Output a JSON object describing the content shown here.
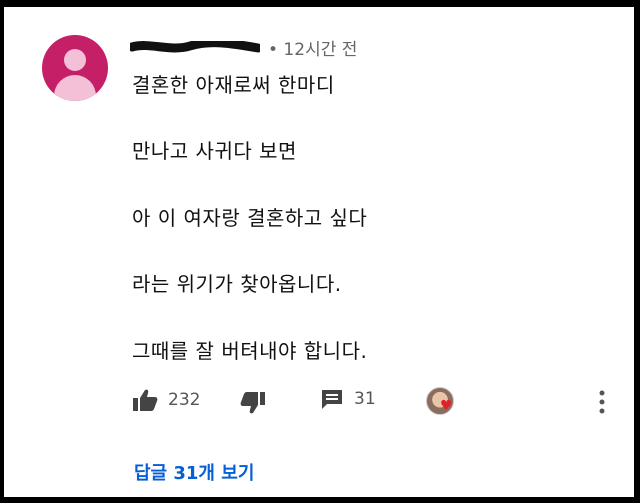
{
  "comment": {
    "timestamp": "• 12시간 전",
    "lines": [
      "결혼한 아재로써 한마디",
      "만나고 사귀다 보면",
      "아 이 여자랑 결혼하고 싶다",
      "라는 위기가 찾아옵니다.",
      "그때를 잘 버텨내야 합니다."
    ]
  },
  "actions": {
    "like_icon": "thumbs-up-icon",
    "like_count": "232",
    "dislike_icon": "thumbs-down-icon",
    "reply_icon": "comment-icon",
    "reply_count": "31",
    "creator_heart_icon": "creator-heart-icon",
    "more_icon": "more-vert-icon"
  },
  "replies_link": "답글 31개 보기",
  "colors": {
    "avatar_bg": "#c51f68",
    "link": "#065fd4",
    "heart": "#e0202b"
  }
}
